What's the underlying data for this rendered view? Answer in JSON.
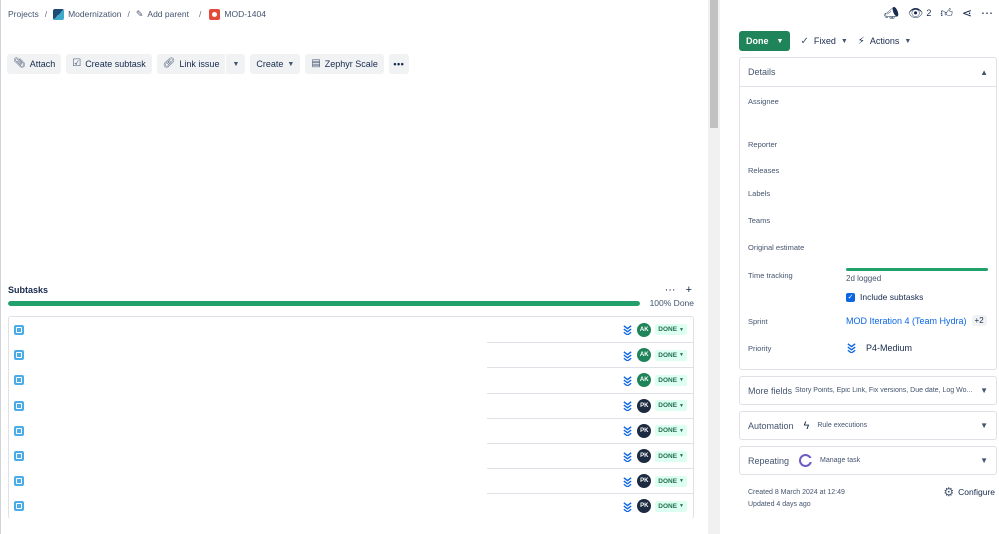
{
  "breadcrumbs": {
    "projects": "Projects",
    "project": "Modernization",
    "add_parent": "Add parent",
    "issue_key": "MOD-1404"
  },
  "toolbar": {
    "attach": "Attach",
    "create_subtask": "Create subtask",
    "link_issue": "Link issue",
    "create": "Create",
    "zephyr": "Zephyr Scale",
    "more": "•••"
  },
  "subtasks": {
    "title": "Subtasks",
    "more": "···",
    "add": "+",
    "progress_percent": 100,
    "progress_label": "100% Done",
    "items": [
      {
        "assignee": "AK",
        "status": "DONE"
      },
      {
        "assignee": "AK",
        "status": "DONE"
      },
      {
        "assignee": "AK",
        "status": "DONE"
      },
      {
        "assignee": "PK",
        "status": "DONE"
      },
      {
        "assignee": "PK",
        "status": "DONE"
      },
      {
        "assignee": "PK",
        "status": "DONE"
      },
      {
        "assignee": "PK",
        "status": "DONE"
      },
      {
        "assignee": "PK",
        "status": "DONE"
      }
    ]
  },
  "header_icons": {
    "watch_count": "2"
  },
  "status": {
    "current": "Done",
    "resolution": "Fixed",
    "actions": "Actions"
  },
  "details": {
    "title": "Details",
    "assignee_label": "Assignee",
    "reporter_label": "Reporter",
    "releases_label": "Releases",
    "labels_label": "Labels",
    "teams_label": "Teams",
    "original_estimate_label": "Original estimate",
    "time_tracking_label": "Time tracking",
    "time_logged": "2d logged",
    "include_subtasks": "Include subtasks",
    "sprint_label": "Sprint",
    "sprint_value": "MOD Iteration 4 (Team Hydra)",
    "sprint_extra": "+2",
    "priority_label": "Priority",
    "priority_value": "P4-Medium"
  },
  "more_fields": {
    "title": "More fields",
    "summary": "Story Points, Epic Link, Fix versions, Due date, Log Wo..."
  },
  "automation": {
    "title": "Automation",
    "link": "Rule executions"
  },
  "repeating": {
    "title": "Repeating",
    "link": "Manage task"
  },
  "meta": {
    "created": "Created 8 March 2024 at 12:49",
    "updated": "Updated 4 days ago",
    "configure": "Configure"
  },
  "colors": {
    "done_green": "#1f845a",
    "progress_green": "#22a06b",
    "link_blue": "#0c66e4"
  }
}
